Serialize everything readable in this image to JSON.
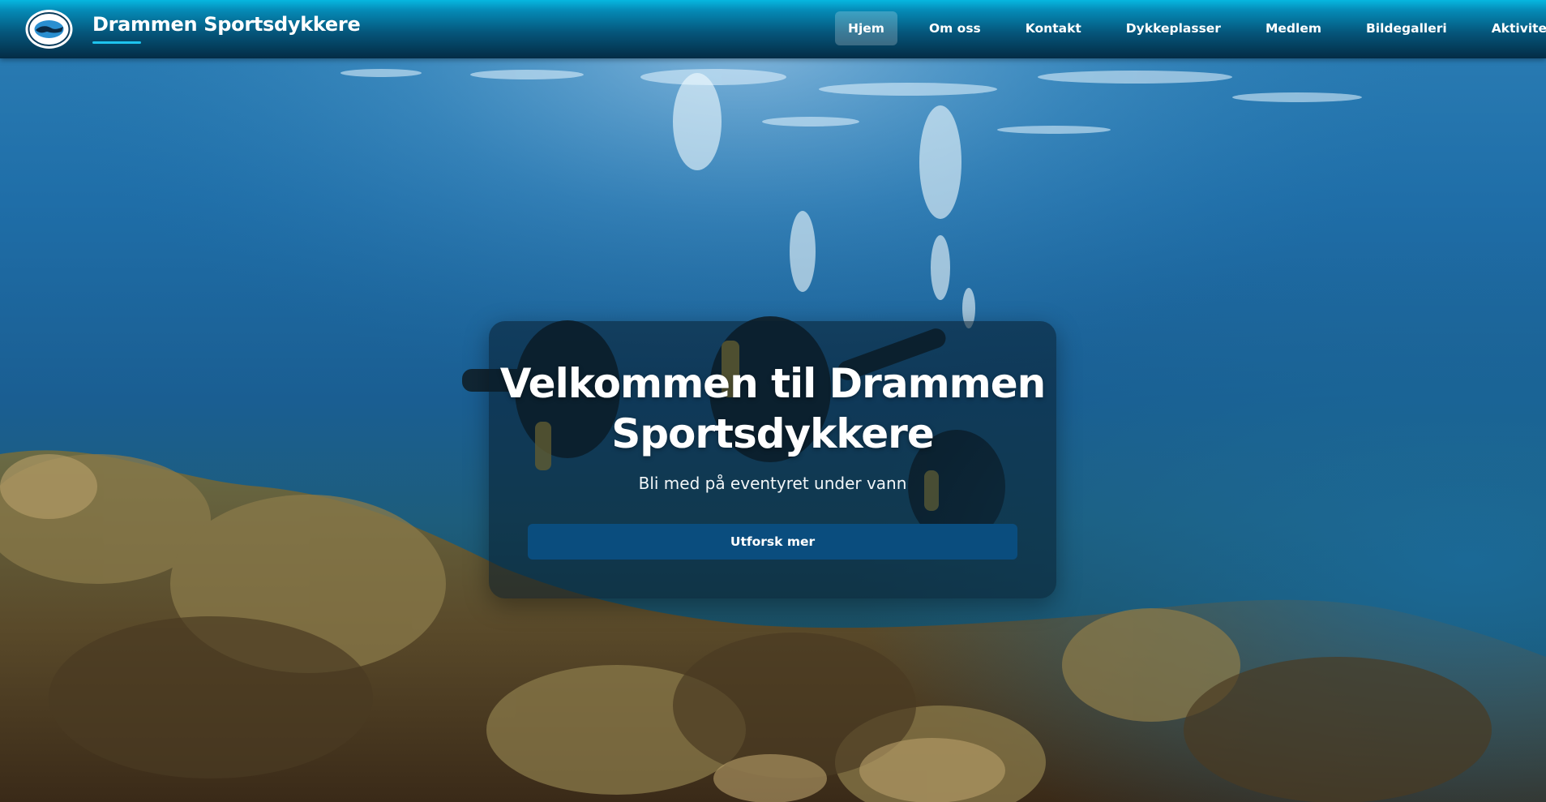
{
  "site": {
    "name": "Drammen Sportsdykkere",
    "logo_icon": "diver-club-logo"
  },
  "nav": {
    "items": [
      {
        "label": "Hjem",
        "active": true
      },
      {
        "label": "Om oss",
        "active": false
      },
      {
        "label": "Kontakt",
        "active": false
      },
      {
        "label": "Dykkeplasser",
        "active": false
      },
      {
        "label": "Medlem",
        "active": false
      },
      {
        "label": "Bildegalleri",
        "active": false
      },
      {
        "label": "Aktiviteter",
        "active": false
      }
    ]
  },
  "hero": {
    "title": "Velkommen til Drammen Sportsdykkere",
    "subtitle": "Bli med på eventyret under vann",
    "cta_label": "Utforsk mer",
    "background": "underwater-divers-photo"
  },
  "colors": {
    "nav_top": "#06b7e0",
    "nav_bottom": "#042c45",
    "accent": "#1ec4ee",
    "button": "#0a4d7e"
  }
}
